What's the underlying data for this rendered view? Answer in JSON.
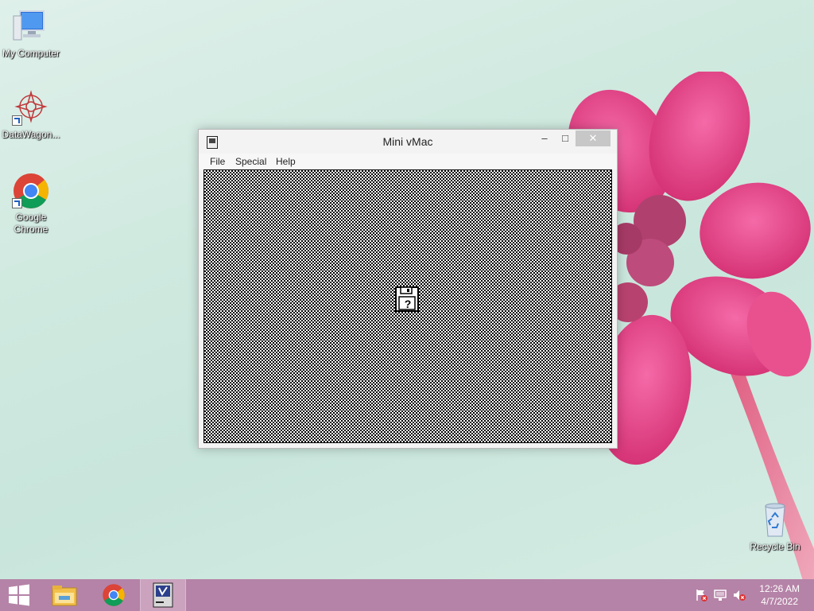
{
  "desktop": {
    "icons": [
      {
        "label": "My Computer",
        "icon": "computer-icon"
      },
      {
        "label": "DataWagon...",
        "icon": "datawagon-icon"
      },
      {
        "label": "Google Chrome",
        "icon": "chrome-icon"
      },
      {
        "label": "Recycle Bin",
        "icon": "recycle-bin-icon"
      }
    ]
  },
  "window": {
    "title": "Mini vMac",
    "buttons": {
      "minimize": "–",
      "maximize": "□",
      "close": "✕"
    },
    "menu": [
      "File",
      "Special",
      "Help"
    ],
    "screen": {
      "icon": "question-disk-icon",
      "glyph": "?"
    }
  },
  "taskbar": {
    "items": [
      "start-icon",
      "file-explorer-icon",
      "chrome-icon",
      "minivmac-icon"
    ],
    "tray": [
      "action-center-flag-icon",
      "network-icon",
      "volume-muted-icon"
    ],
    "clock": {
      "time": "12:26 AM",
      "date": "4/7/2022"
    }
  },
  "colors": {
    "taskbar": "#b583a7",
    "flower": "#e23c82"
  }
}
